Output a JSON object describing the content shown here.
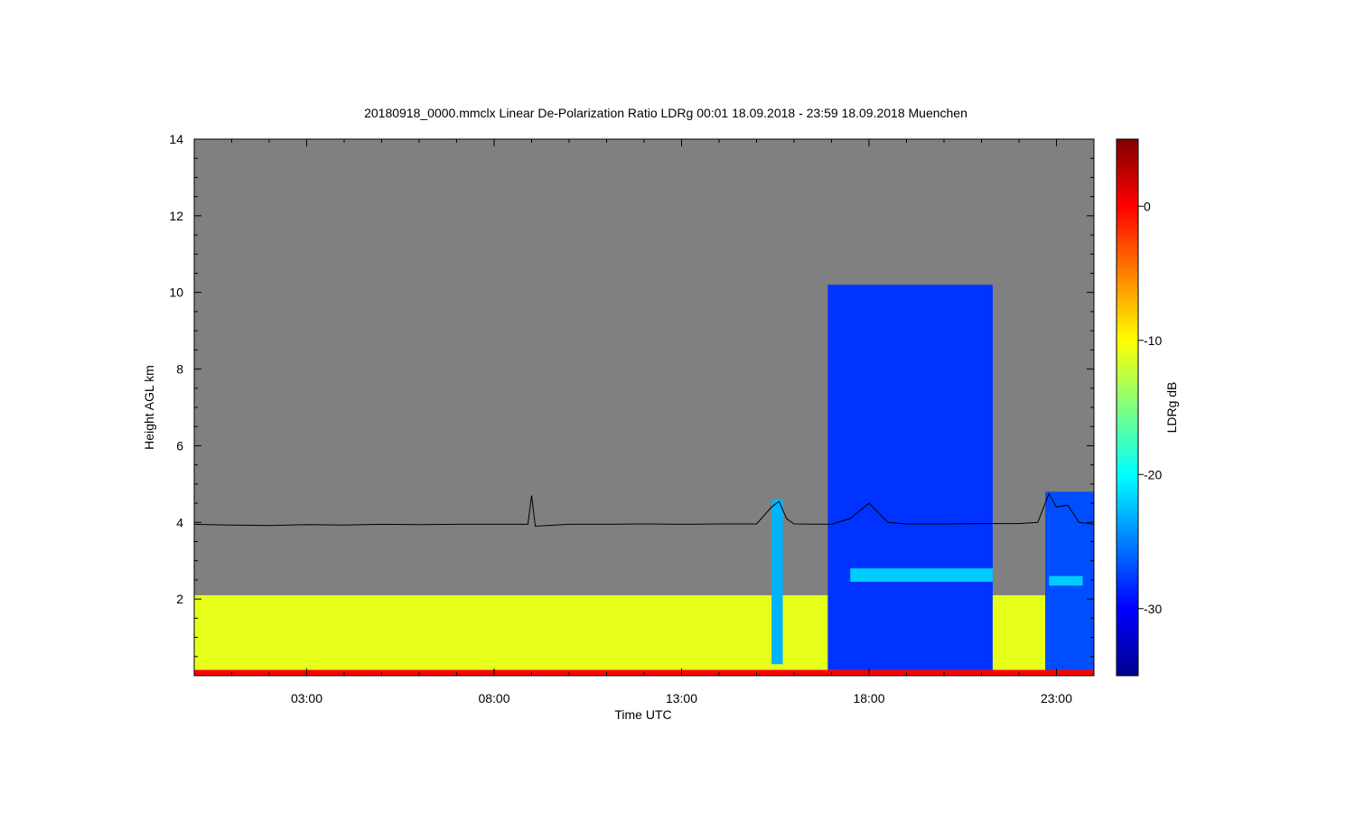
{
  "chart_data": {
    "type": "heatmap",
    "title": "20180918_0000.mmclx Linear De-Polarization Ratio LDRg   00:01 18.09.2018 - 23:59 18.09.2018 Muenchen",
    "xlabel": "Time UTC",
    "ylabel": "Height AGL km",
    "colorbar_label": "LDRg dB",
    "xlim_hours": [
      0.0,
      24.0
    ],
    "ylim_km": [
      0.0,
      14.0
    ],
    "x_ticks": [
      {
        "value": 3,
        "label": "03:00"
      },
      {
        "value": 8,
        "label": "08:00"
      },
      {
        "value": 13,
        "label": "13:00"
      },
      {
        "value": 18,
        "label": "18:00"
      },
      {
        "value": 23,
        "label": "23:00"
      }
    ],
    "y_ticks": [
      {
        "value": 2,
        "label": "2"
      },
      {
        "value": 4,
        "label": "4"
      },
      {
        "value": 6,
        "label": "6"
      },
      {
        "value": 8,
        "label": "8"
      },
      {
        "value": 10,
        "label": "10"
      },
      {
        "value": 12,
        "label": "12"
      },
      {
        "value": 14,
        "label": "14"
      }
    ],
    "colorbar_range": [
      -35,
      5
    ],
    "colorbar_ticks": [
      {
        "value": 0,
        "label": "0"
      },
      {
        "value": -10,
        "label": "-10"
      },
      {
        "value": -20,
        "label": "-20"
      },
      {
        "value": -30,
        "label": "-30"
      }
    ],
    "colormap": [
      "#00008f",
      "#0000ff",
      "#0080ff",
      "#00ffff",
      "#80ff80",
      "#ffff00",
      "#ff8000",
      "#ff0000",
      "#800000"
    ],
    "background_color": "#808080",
    "regions": [
      {
        "name": "boundary-layer",
        "t0": 0.0,
        "t1": 17.2,
        "h0": 0.15,
        "h1": 2.1,
        "ldr": -11
      },
      {
        "name": "ice-cloud-main",
        "t0": 16.9,
        "t1": 21.3,
        "h0": 0.15,
        "h1": 10.2,
        "ldr": -28
      },
      {
        "name": "ice-cloud-late",
        "t0": 22.7,
        "t1": 24.0,
        "h0": 0.15,
        "h1": 4.8,
        "ldr": -27
      },
      {
        "name": "melting-layer-1",
        "t0": 17.5,
        "t1": 21.3,
        "h0": 2.45,
        "h1": 2.8,
        "ldr": -22
      },
      {
        "name": "melting-layer-2",
        "t0": 22.8,
        "t1": 23.7,
        "h0": 2.35,
        "h1": 2.6,
        "ldr": -22
      },
      {
        "name": "shower-15h",
        "t0": 15.4,
        "t1": 15.7,
        "h0": 0.3,
        "h1": 4.6,
        "ldr": -23
      },
      {
        "name": "boundary-layer-late",
        "t0": 21.3,
        "t1": 22.7,
        "h0": 0.15,
        "h1": 2.1,
        "ldr": -11
      },
      {
        "name": "surface-clutter",
        "t0": 0.0,
        "t1": 24.0,
        "h0": 0.0,
        "h1": 0.15,
        "ldr": 0
      }
    ],
    "line_series": {
      "name": "",
      "color": "#000000",
      "x_hours": [
        0,
        1,
        2,
        3,
        4,
        5,
        6,
        7,
        8,
        8.9,
        9.0,
        9.1,
        10,
        11,
        12,
        13,
        14,
        15,
        15.4,
        15.6,
        15.8,
        16,
        17,
        17.5,
        18.0,
        18.5,
        19,
        20,
        21,
        22,
        22.5,
        22.8,
        23.0,
        23.3,
        23.6,
        24
      ],
      "y_km": [
        3.95,
        3.93,
        3.92,
        3.94,
        3.93,
        3.95,
        3.94,
        3.95,
        3.95,
        3.95,
        4.7,
        3.9,
        3.95,
        3.95,
        3.96,
        3.95,
        3.96,
        3.96,
        4.4,
        4.55,
        4.1,
        3.96,
        3.95,
        4.1,
        4.5,
        4.0,
        3.96,
        3.96,
        3.97,
        3.97,
        4.0,
        4.75,
        4.4,
        4.45,
        4.0,
        3.95
      ]
    }
  }
}
